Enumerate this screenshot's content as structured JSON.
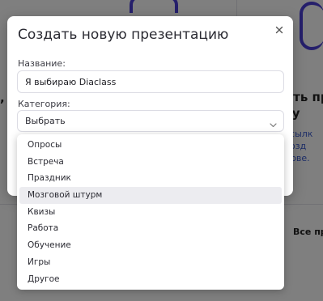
{
  "background": {
    "heading_fragment": "ать пр\nту",
    "text_fragment": "ссылк\nсозд\nнове.",
    "comma": ",",
    "all_presentations": "Все пр"
  },
  "modal": {
    "title": "Создать новую презентацию",
    "close_icon": "close-icon",
    "name_label": "Название:",
    "name_value": "Я выбираю Diaclass",
    "category_label": "Категория:",
    "category_selected": "Выбрать",
    "chevron_icon": "chevron-down-icon"
  },
  "dropdown": {
    "options": [
      "Опросы",
      "Встреча",
      "Праздник",
      "Мозговой штурм",
      "Квизы",
      "Работа",
      "Обучение",
      "Игры",
      "Другое"
    ],
    "hovered_index": 3
  },
  "colors": {
    "overlay": "rgba(0,0,0,0.5)",
    "accent": "#4a3fd6",
    "hover": "#ececf0"
  }
}
